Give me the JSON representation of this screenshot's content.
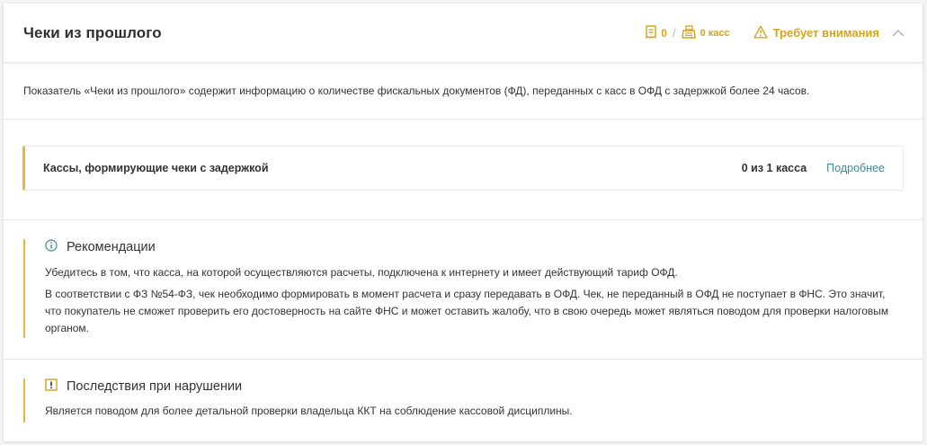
{
  "header": {
    "title": "Чеки из прошлого",
    "receipts_count": "0",
    "separator": "/",
    "kkt_count": "0 касс",
    "status": "Требует внимания",
    "receipt_icon": "receipt-icon",
    "register_icon": "cash-register-icon",
    "warning_icon": "warning-triangle-icon",
    "collapse_icon": "chevron-up-icon"
  },
  "description": "Показатель «Чеки из прошлого» содержит информацию о количестве фискальных документов (ФД), переданных с касс в ОФД с задержкой более 24 часов.",
  "registers_row": {
    "label": "Кассы, формирующие чеки с задержкой",
    "count": "0 из 1 касса",
    "link": "Подробнее"
  },
  "recommendations": {
    "title": "Рекомендации",
    "icon": "info-icon",
    "p1": "Убедитесь в том, что касса, на которой осуществляются расчеты, подключена к интернету и имеет действующий тариф ОФД.",
    "p2": "В соответствии с ФЗ №54-ФЗ, чек необходимо формировать в момент расчета и сразу передавать в ОФД. Чек, не переданный в ОФД не поступает в ФНС. Это значит, что покупатель не сможет проверить его достоверность на сайте ФНС и может оставить жалобу, что в свою очередь может являться поводом для проверки налоговым органом."
  },
  "consequences": {
    "title": "Последствия при нарушении",
    "icon": "exclamation-box-icon",
    "p1": "Является поводом для более детальной проверки владельца ККТ на соблюдение кассовой дисциплины."
  },
  "colors": {
    "accent": "#e5b73b",
    "status": "#d4a41c",
    "link": "#3d8a95",
    "info": "#3d8a95"
  }
}
